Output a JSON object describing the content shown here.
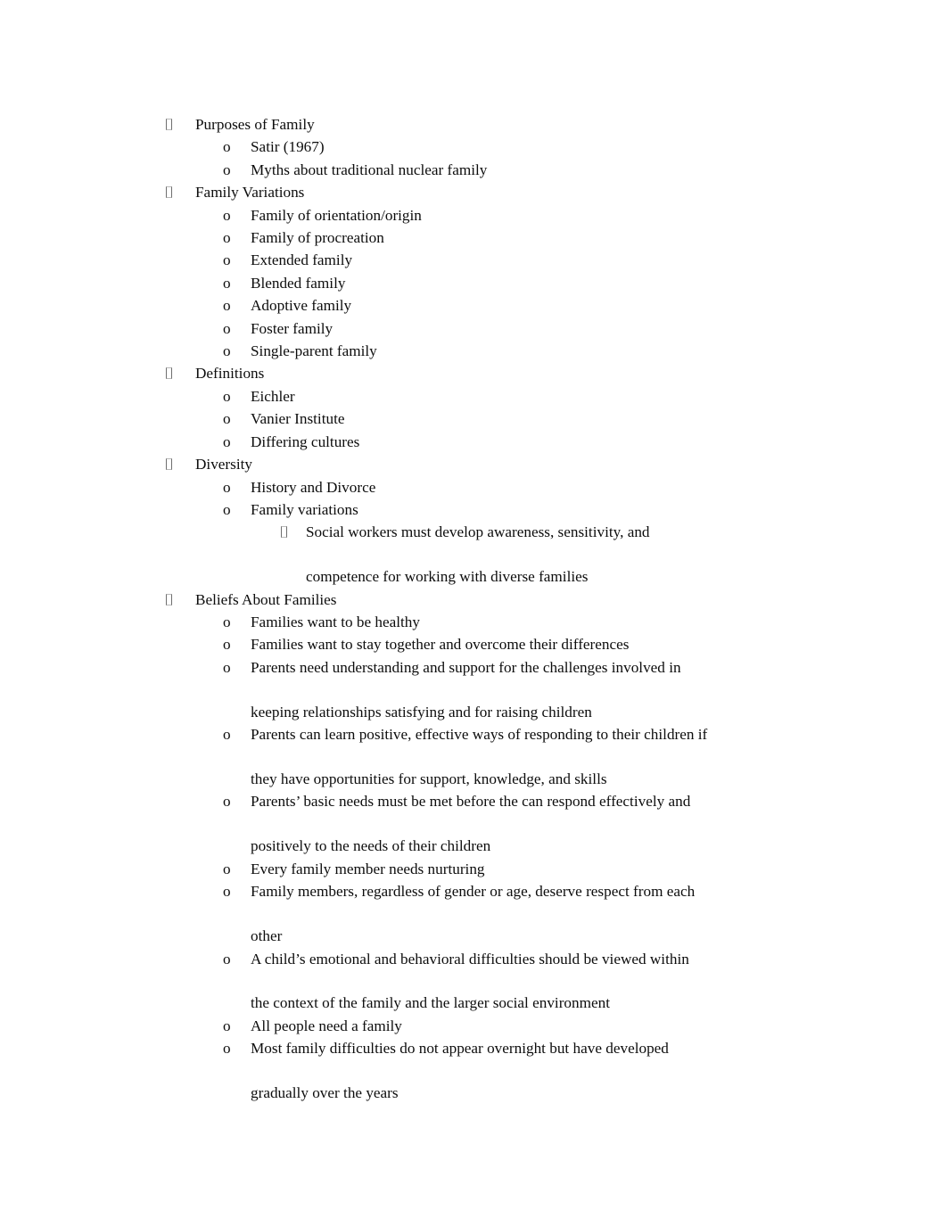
{
  "document": {
    "background_color": "#ffffff",
    "text_color": "#0d0d0d",
    "bullet_glyph_color": "#6e6e6e",
    "level1_marker": "tofu-box",
    "level2_marker": "o",
    "level3_marker": "tofu-box",
    "outline": [
      {
        "level": 1,
        "text": "Purposes of Family",
        "children": [
          {
            "level": 2,
            "text": "Satir (1967)"
          },
          {
            "level": 2,
            "text": "Myths about traditional nuclear family"
          }
        ]
      },
      {
        "level": 1,
        "text": "Family Variations",
        "children": [
          {
            "level": 2,
            "text": "Family of orientation/origin"
          },
          {
            "level": 2,
            "text": "Family of procreation"
          },
          {
            "level": 2,
            "text": "Extended family"
          },
          {
            "level": 2,
            "text": "Blended family"
          },
          {
            "level": 2,
            "text": "Adoptive family"
          },
          {
            "level": 2,
            "text": "Foster family"
          },
          {
            "level": 2,
            "text": "Single-parent family"
          }
        ]
      },
      {
        "level": 1,
        "text": "Definitions",
        "children": [
          {
            "level": 2,
            "text": "Eichler"
          },
          {
            "level": 2,
            "text": "Vanier Institute"
          },
          {
            "level": 2,
            "text": "Differing cultures"
          }
        ]
      },
      {
        "level": 1,
        "text": "Diversity",
        "children": [
          {
            "level": 2,
            "text": "History and Divorce"
          },
          {
            "level": 2,
            "text": "Family variations",
            "children": [
              {
                "level": 3,
                "text": "Social workers must develop awareness, sensitivity, and",
                "continuation": "competence for working with diverse families"
              }
            ]
          }
        ]
      },
      {
        "level": 1,
        "text": "Beliefs About Families",
        "children": [
          {
            "level": 2,
            "text": "Families want to be healthy"
          },
          {
            "level": 2,
            "text": "Families want to stay together and overcome their differences"
          },
          {
            "level": 2,
            "text": "Parents need understanding and support for the challenges involved in",
            "continuation": "keeping relationships satisfying and for raising children"
          },
          {
            "level": 2,
            "text": "Parents can learn positive, effective ways of responding to their children if",
            "continuation": "they have opportunities for support, knowledge, and skills"
          },
          {
            "level": 2,
            "text": "Parents’ basic needs must be met before the can respond effectively and",
            "continuation": "positively to the needs of their children"
          },
          {
            "level": 2,
            "text": "Every family member needs nurturing"
          },
          {
            "level": 2,
            "text": "Family members, regardless of gender or age, deserve respect from each",
            "continuation": "other"
          },
          {
            "level": 2,
            "text": "A child’s emotional and behavioral difficulties should be viewed within",
            "continuation": "the context of the family and the larger social environment"
          },
          {
            "level": 2,
            "text": "All people need a family"
          },
          {
            "level": 2,
            "text": "Most family difficulties do not appear overnight but have developed",
            "continuation": "gradually over the years"
          }
        ]
      }
    ],
    "lines": [
      {
        "indent": 1,
        "marker": "tofu",
        "text": "Purposes of Family"
      },
      {
        "indent": 2,
        "marker": "o",
        "text": "Satir (1967)"
      },
      {
        "indent": 2,
        "marker": "o",
        "text": "Myths about traditional nuclear family"
      },
      {
        "indent": 1,
        "marker": "tofu",
        "text": "Family Variations"
      },
      {
        "indent": 2,
        "marker": "o",
        "text": "Family of orientation/origin"
      },
      {
        "indent": 2,
        "marker": "o",
        "text": "Family of procreation"
      },
      {
        "indent": 2,
        "marker": "o",
        "text": "Extended family"
      },
      {
        "indent": 2,
        "marker": "o",
        "text": "Blended family"
      },
      {
        "indent": 2,
        "marker": "o",
        "text": "Adoptive family"
      },
      {
        "indent": 2,
        "marker": "o",
        "text": "Foster family"
      },
      {
        "indent": 2,
        "marker": "o",
        "text": "Single-parent family"
      },
      {
        "indent": 1,
        "marker": "tofu",
        "text": "Definitions"
      },
      {
        "indent": 2,
        "marker": "o",
        "text": "Eichler"
      },
      {
        "indent": 2,
        "marker": "o",
        "text": "Vanier Institute"
      },
      {
        "indent": 2,
        "marker": "o",
        "text": "Differing cultures"
      },
      {
        "indent": 1,
        "marker": "tofu",
        "text": "Diversity"
      },
      {
        "indent": 2,
        "marker": "o",
        "text": "History and Divorce"
      },
      {
        "indent": 2,
        "marker": "o",
        "text": "Family variations"
      },
      {
        "indent": 3,
        "marker": "tofu",
        "text": "Social workers must develop awareness, sensitivity, and"
      },
      {
        "indent": 3,
        "marker": "none",
        "text": "competence for working with diverse families"
      },
      {
        "indent": 1,
        "marker": "tofu",
        "text": "Beliefs About Families"
      },
      {
        "indent": 2,
        "marker": "o",
        "text": "Families want to be healthy"
      },
      {
        "indent": 2,
        "marker": "o",
        "text": "Families want to stay together and overcome their differences"
      },
      {
        "indent": 2,
        "marker": "o",
        "text": "Parents need understanding and support for the challenges involved in"
      },
      {
        "indent": 2,
        "marker": "none",
        "text": "keeping relationships satisfying and for raising children"
      },
      {
        "indent": 2,
        "marker": "o",
        "text": "Parents can learn positive, effective ways of responding to their children if"
      },
      {
        "indent": 2,
        "marker": "none",
        "text": "they have opportunities for support, knowledge, and skills"
      },
      {
        "indent": 2,
        "marker": "o",
        "text": "Parents’ basic needs must be met before the can respond effectively and"
      },
      {
        "indent": 2,
        "marker": "none",
        "text": "positively to the needs of their children"
      },
      {
        "indent": 2,
        "marker": "o",
        "text": "Every family member needs nurturing"
      },
      {
        "indent": 2,
        "marker": "o",
        "text": "Family members, regardless of gender or age, deserve respect from each"
      },
      {
        "indent": 2,
        "marker": "none",
        "text": "other"
      },
      {
        "indent": 2,
        "marker": "o",
        "text": "A child’s emotional and behavioral difficulties should be viewed within"
      },
      {
        "indent": 2,
        "marker": "none",
        "text": "the context of the family and the larger social environment"
      },
      {
        "indent": 2,
        "marker": "o",
        "text": "All people need a family"
      },
      {
        "indent": 2,
        "marker": "o",
        "text": "Most family difficulties do not appear overnight but have developed"
      },
      {
        "indent": 2,
        "marker": "none",
        "text": "gradually over the years"
      }
    ]
  }
}
